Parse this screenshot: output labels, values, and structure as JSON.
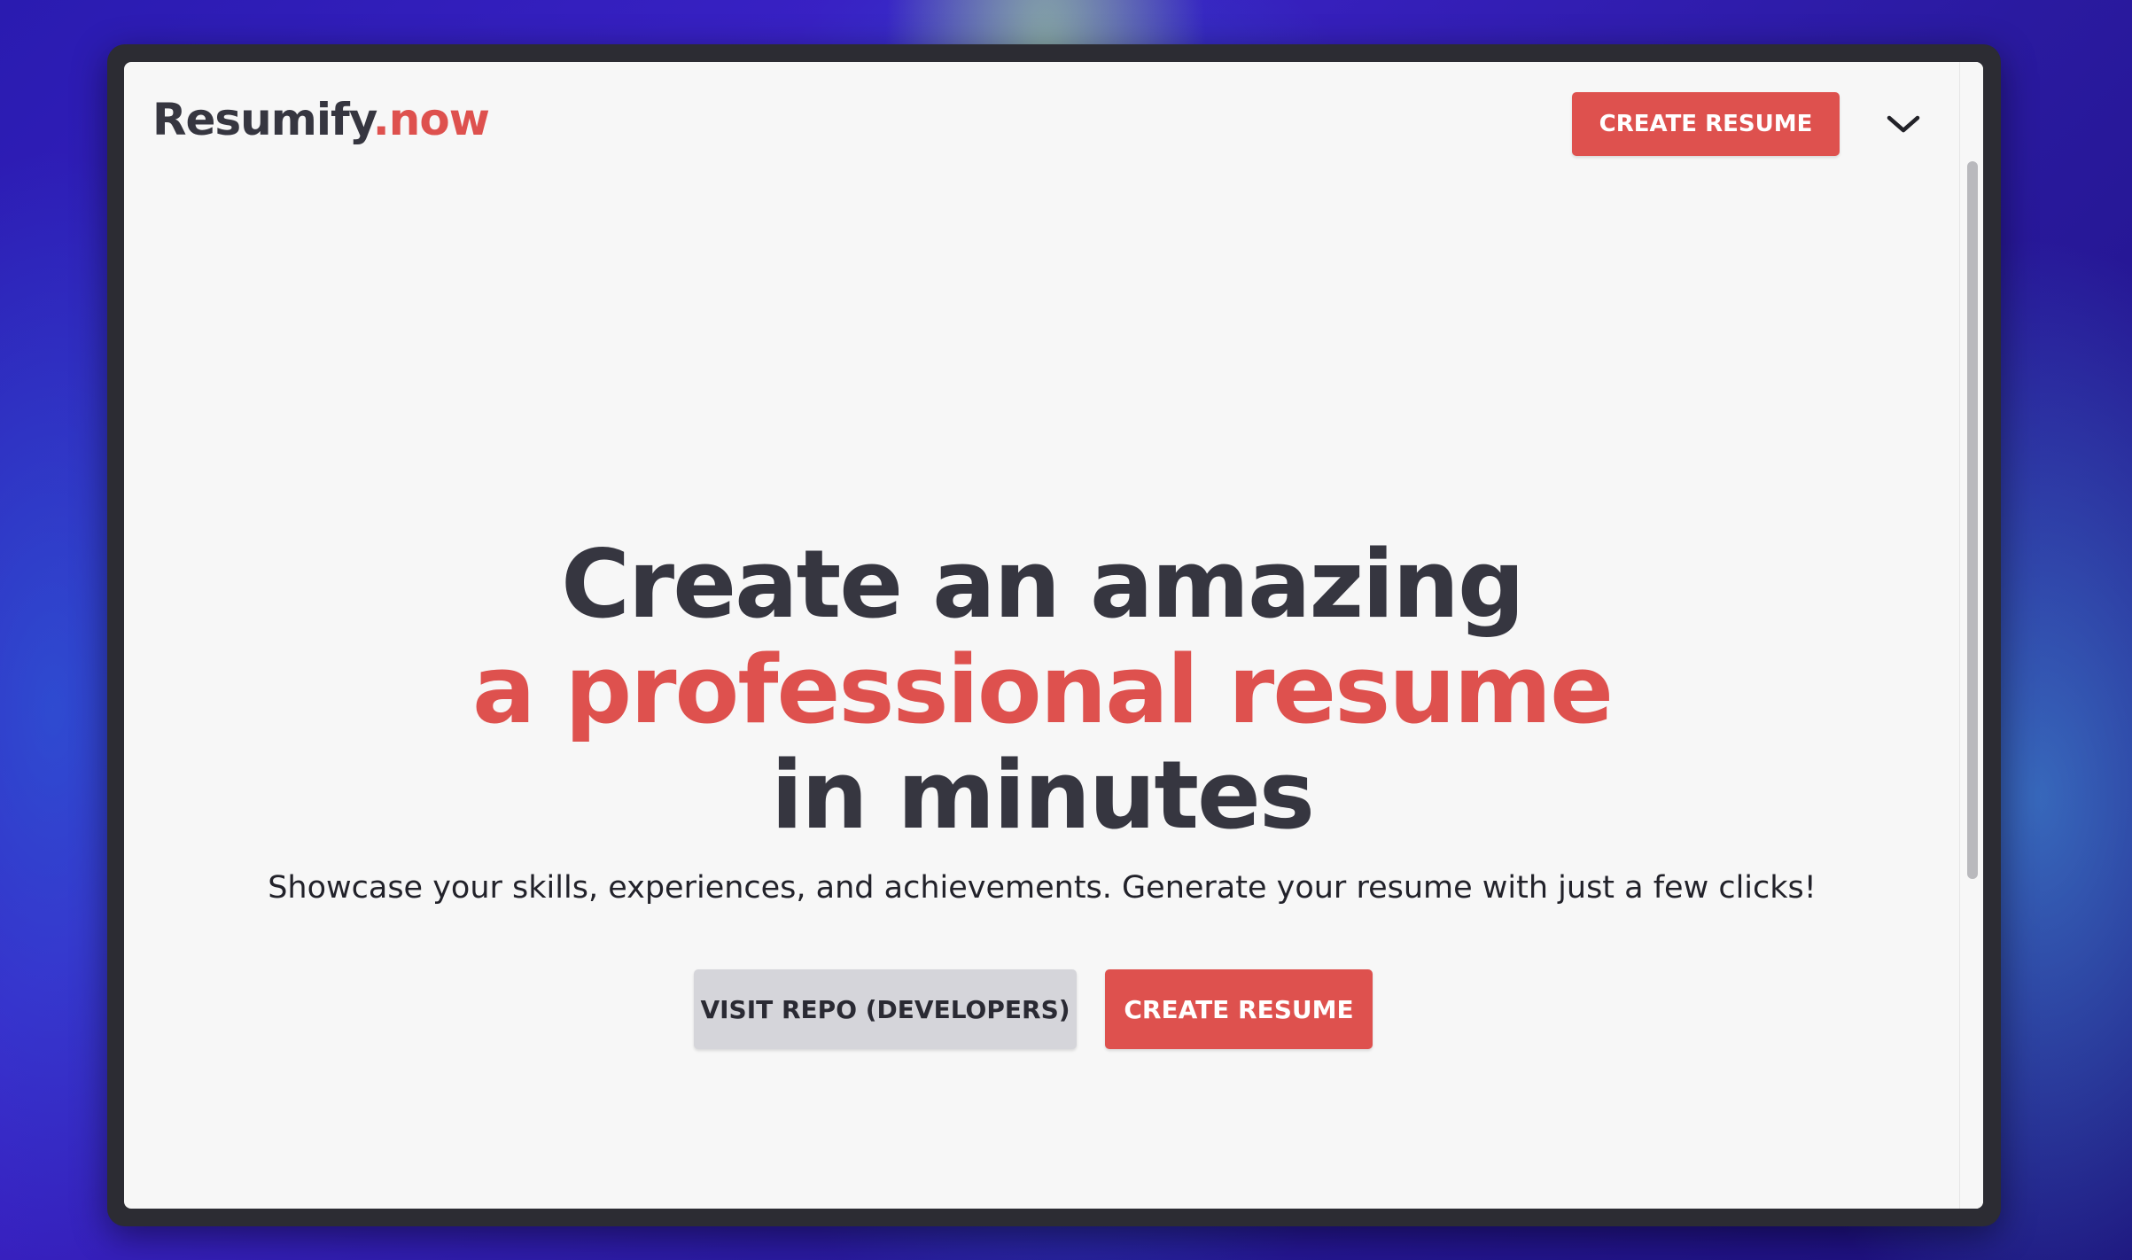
{
  "navbar": {
    "logo_main": "Resumify",
    "logo_accent": ".now",
    "cta_label": "CREATE RESUME",
    "menu_icon": "chevron-down-icon"
  },
  "hero": {
    "title_line1": "Create an amazing",
    "title_line2": "a professional resume",
    "title_line3": "in minutes",
    "subtitle": "Showcase your skills, experiences, and achievements. Generate your resume with just a few clicks!",
    "repo_button_label": "VISIT REPO (DEVELOPERS)",
    "cta_button_label": "CREATE RESUME"
  },
  "colors": {
    "accent": "#de514e",
    "text_dark": "#363640",
    "page_background": "#f7f7f7",
    "secondary_button": "#d5d5da"
  }
}
